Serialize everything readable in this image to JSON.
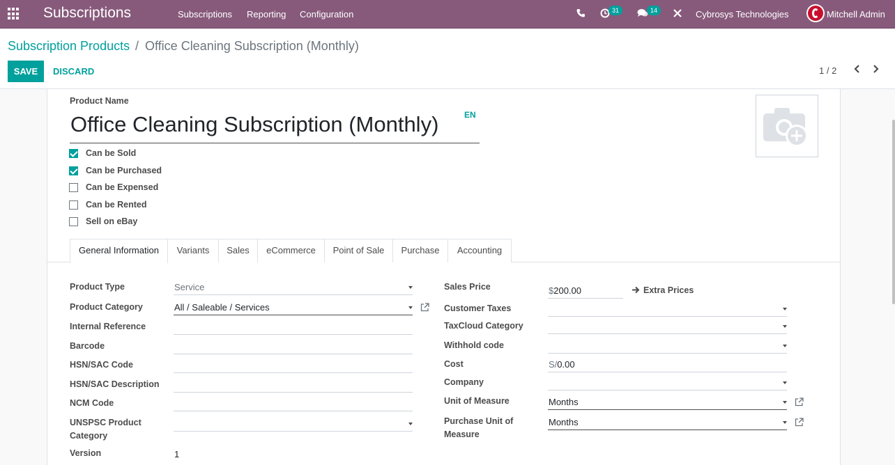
{
  "navbar": {
    "app_name": "Subscriptions",
    "menu": [
      "Subscriptions",
      "Reporting",
      "Configuration"
    ],
    "activity_count": "31",
    "messages_count": "14",
    "company": "Cybrosys Technologies",
    "user": "Mitchell Admin",
    "accent": "#875a7b"
  },
  "breadcrumb": {
    "parent": "Subscription Products",
    "separator": "/",
    "current": "Office Cleaning Subscription (Monthly)"
  },
  "actions": {
    "save": "SAVE",
    "discard": "DISCARD",
    "pager": "1 / 2"
  },
  "product": {
    "name_label": "Product Name",
    "name": "Office Cleaning Subscription (Monthly)",
    "lang": "EN",
    "flags": [
      {
        "label": "Can be Sold",
        "checked": true
      },
      {
        "label": "Can be Purchased",
        "checked": true
      },
      {
        "label": "Can be Expensed",
        "checked": false
      },
      {
        "label": "Can be Rented",
        "checked": false
      },
      {
        "label": "Sell on eBay",
        "checked": false
      }
    ]
  },
  "tabs": [
    "General Information",
    "Variants",
    "Sales",
    "eCommerce",
    "Point of Sale",
    "Purchase",
    "Accounting"
  ],
  "left_fields": {
    "product_type": {
      "label": "Product Type",
      "value": "Service"
    },
    "product_category": {
      "label": "Product Category",
      "value": "All / Saleable / Services"
    },
    "internal_reference": {
      "label": "Internal Reference",
      "value": ""
    },
    "barcode": {
      "label": "Barcode",
      "value": ""
    },
    "hsn_code": {
      "label": "HSN/SAC Code",
      "value": ""
    },
    "hsn_description": {
      "label": "HSN/SAC Description",
      "value": ""
    },
    "ncm_code": {
      "label": "NCM Code",
      "value": ""
    },
    "unspsc_line1": "UNSPSC Product",
    "unspsc_line2": "Category",
    "version": {
      "label": "Version",
      "value": "1"
    }
  },
  "right_fields": {
    "sales_price": {
      "label": "Sales Price",
      "currency": "$",
      "value": "200.00"
    },
    "extra_prices": "Extra Prices",
    "customer_taxes": {
      "label": "Customer Taxes",
      "value": ""
    },
    "taxcloud_category": {
      "label": "TaxCloud Category",
      "value": ""
    },
    "withhold_code": {
      "label": "Withhold code",
      "value": ""
    },
    "cost": {
      "label": "Cost",
      "currency": "S/",
      "value": "0.00"
    },
    "company": {
      "label": "Company",
      "value": ""
    },
    "uom": {
      "label": "Unit of Measure",
      "value": "Months"
    },
    "purchase_uom_line1": "Purchase Unit of",
    "purchase_uom_line2": "Measure",
    "purchase_uom_value": "Months"
  },
  "colors": {
    "primary": "#00a09d",
    "navbar": "#875a7b"
  }
}
